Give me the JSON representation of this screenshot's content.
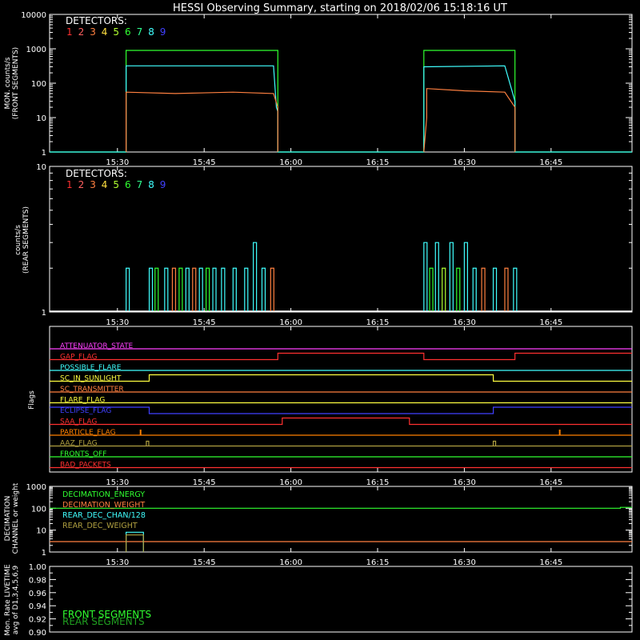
{
  "title": "HESSI Observing Summary, starting on 2018/02/06 15:18:16 UT",
  "detectors": {
    "label": "DETECTORS:",
    "numbers": [
      "1",
      "2",
      "3",
      "4",
      "5",
      "6",
      "7",
      "8",
      "9"
    ],
    "colors": [
      "#ff3030",
      "#ff6060",
      "#ff8040",
      "#ffe040",
      "#b0ff30",
      "#30ff30",
      "#30ff90",
      "#40ffff",
      "#4040ff"
    ]
  },
  "time_axis": {
    "start": "15:18:16",
    "end": "16:59:00",
    "ticks": [
      "15:30",
      "15:45",
      "16:00",
      "16:15",
      "16:30",
      "16:45"
    ]
  },
  "chart_data": [
    {
      "id": "front",
      "type": "line",
      "ylabel": [
        "MON. counts/s",
        "(FRONT SEGMENTS)"
      ],
      "y_scale": "log",
      "ylim": [
        1,
        10000
      ],
      "y_ticks": [
        "1",
        "10",
        "100",
        "1000",
        "10000"
      ],
      "series": [
        {
          "color": "#30ff30",
          "x": [
            "15:18:16",
            "15:31:30",
            "15:31:30",
            "15:57:45",
            "15:57:45",
            "16:23:00",
            "16:23:00",
            "16:38:45",
            "16:38:45",
            "16:59:00"
          ],
          "y": [
            1,
            1,
            900,
            900,
            1,
            1,
            900,
            900,
            1,
            1
          ]
        },
        {
          "color": "#40ffff",
          "x": [
            "15:18:16",
            "15:31:30",
            "15:31:30",
            "15:57:00",
            "15:57:30",
            "15:57:45",
            "15:57:45",
            "16:23:00",
            "16:23:00",
            "16:37:00",
            "16:38:45",
            "16:38:45",
            "16:59:00"
          ],
          "y": [
            1,
            1,
            320,
            320,
            20,
            15,
            1,
            1,
            300,
            320,
            30,
            1,
            1
          ]
        },
        {
          "color": "#ff8040",
          "x": [
            "15:31:30",
            "15:31:30",
            "15:40:00",
            "15:50:00",
            "15:57:00",
            "15:57:45",
            "15:57:45"
          ],
          "y": [
            1,
            55,
            50,
            55,
            50,
            20,
            1
          ]
        },
        {
          "color": "#ff8040",
          "x": [
            "16:23:00",
            "16:23:30",
            "16:23:30",
            "16:30:00",
            "16:37:00",
            "16:38:45",
            "16:38:45"
          ],
          "y": [
            1,
            10,
            70,
            60,
            55,
            20,
            1
          ]
        }
      ]
    },
    {
      "id": "rear",
      "type": "line",
      "ylabel": [
        "counts/s",
        "(REAR SEGMENTS)"
      ],
      "y_scale": "log",
      "ylim": [
        1,
        10
      ],
      "y_ticks": [
        "1",
        "10"
      ],
      "baseline": "#ffffff",
      "spikes": [
        {
          "t": "15:31:30",
          "y": 2,
          "color": "#40ffff"
        },
        {
          "t": "15:35:30",
          "y": 2,
          "color": "#40ffff"
        },
        {
          "t": "15:36:30",
          "y": 2,
          "color": "#30ff30"
        },
        {
          "t": "15:38:10",
          "y": 2,
          "color": "#40ffff"
        },
        {
          "t": "15:39:30",
          "y": 2,
          "color": "#ff8040"
        },
        {
          "t": "15:40:40",
          "y": 2,
          "color": "#30ff30"
        },
        {
          "t": "15:41:50",
          "y": 2,
          "color": "#40ffff"
        },
        {
          "t": "15:43:00",
          "y": 2,
          "color": "#ff8040"
        },
        {
          "t": "15:44:10",
          "y": 2,
          "color": "#40ffff"
        },
        {
          "t": "15:45:20",
          "y": 2,
          "color": "#30ff30"
        },
        {
          "t": "15:46:30",
          "y": 2,
          "color": "#40ffff"
        },
        {
          "t": "15:48:00",
          "y": 2,
          "color": "#40ffff"
        },
        {
          "t": "15:50:00",
          "y": 2,
          "color": "#40ffff"
        },
        {
          "t": "15:52:00",
          "y": 2,
          "color": "#40ffff"
        },
        {
          "t": "15:53:30",
          "y": 3,
          "color": "#40ffff"
        },
        {
          "t": "15:55:00",
          "y": 2,
          "color": "#40ffff"
        },
        {
          "t": "15:56:30",
          "y": 2,
          "color": "#ff8040"
        },
        {
          "t": "16:23:00",
          "y": 3,
          "color": "#40ffff"
        },
        {
          "t": "16:24:00",
          "y": 2,
          "color": "#30ff30"
        },
        {
          "t": "16:25:00",
          "y": 3,
          "color": "#40ffff"
        },
        {
          "t": "16:26:10",
          "y": 2,
          "color": "#b0ff30"
        },
        {
          "t": "16:27:30",
          "y": 3,
          "color": "#40ffff"
        },
        {
          "t": "16:28:40",
          "y": 2,
          "color": "#30ff30"
        },
        {
          "t": "16:30:00",
          "y": 3,
          "color": "#40ffff"
        },
        {
          "t": "16:31:30",
          "y": 2,
          "color": "#40ffff"
        },
        {
          "t": "16:33:00",
          "y": 2,
          "color": "#ff8040"
        },
        {
          "t": "16:35:00",
          "y": 2,
          "color": "#40ffff"
        },
        {
          "t": "16:37:00",
          "y": 2,
          "color": "#ff8040"
        },
        {
          "t": "16:38:30",
          "y": 2,
          "color": "#40ffff"
        }
      ]
    },
    {
      "id": "flags",
      "type": "flags",
      "ylabel": "Flags",
      "rows": [
        {
          "name": "ATTENUATOR_STATE",
          "color": "#ff40ff",
          "steps": [
            {
              "t": "15:18:16",
              "v": 0
            }
          ]
        },
        {
          "name": "GAP_FLAG",
          "color": "#ff3030",
          "steps": [
            {
              "t": "15:18:16",
              "v": 0
            },
            {
              "t": "15:57:45",
              "v": 1
            },
            {
              "t": "16:23:00",
              "v": 0
            },
            {
              "t": "16:38:45",
              "v": 1
            }
          ]
        },
        {
          "name": "POSSIBLE_FLARE",
          "color": "#40ffff",
          "steps": [
            {
              "t": "15:18:16",
              "v": 0
            }
          ]
        },
        {
          "name": "SC_IN_SUNLIGHT",
          "color": "#ffff40",
          "steps": [
            {
              "t": "15:18:16",
              "v": 0
            },
            {
              "t": "15:35:30",
              "v": 1
            },
            {
              "t": "16:35:00",
              "v": 0
            }
          ]
        },
        {
          "name": "SC_TRANSMITTER",
          "color": "#ff8040",
          "steps": [
            {
              "t": "15:18:16",
              "v": 0
            }
          ]
        },
        {
          "name": "FLARE_FLAG",
          "color": "#ffff40",
          "steps": [
            {
              "t": "15:18:16",
              "v": 0
            }
          ]
        },
        {
          "name": "ECLIPSE_FLAG",
          "color": "#4040ff",
          "steps": [
            {
              "t": "15:18:16",
              "v": 1
            },
            {
              "t": "15:35:30",
              "v": 0
            },
            {
              "t": "16:35:00",
              "v": 1
            }
          ]
        },
        {
          "name": "SAA_FLAG",
          "color": "#ff3030",
          "steps": [
            {
              "t": "15:18:16",
              "v": 0
            },
            {
              "t": "15:58:30",
              "v": 1
            },
            {
              "t": "16:20:30",
              "v": 0
            }
          ]
        },
        {
          "name": "PARTICLE_FLAG",
          "color": "#ff8000",
          "steps": [
            {
              "t": "15:18:16",
              "v": 0
            }
          ],
          "ticks": [
            "15:34:00",
            "16:46:30"
          ]
        },
        {
          "name": "AAZ_FLAG",
          "color": "#b0a040",
          "steps": [
            {
              "t": "15:18:16",
              "v": 0
            }
          ],
          "pulses": [
            "15:35:00",
            "16:35:00"
          ]
        },
        {
          "name": "FRONTS_OFF",
          "color": "#30ff30",
          "steps": [
            {
              "t": "15:18:16",
              "v": 0
            }
          ]
        },
        {
          "name": "BAD_PACKETS",
          "color": "#ff3030",
          "steps": [
            {
              "t": "15:18:16",
              "v": 0
            }
          ]
        }
      ]
    },
    {
      "id": "decimation",
      "type": "line",
      "ylabel": [
        "DECIMATION",
        "CHANNEL or weight"
      ],
      "y_scale": "log",
      "ylim": [
        1,
        1000
      ],
      "y_ticks": [
        "1",
        "10",
        "100",
        "1000"
      ],
      "legend": [
        {
          "name": "DECIMATION_ENERGY",
          "color": "#30ff30"
        },
        {
          "name": "DECIMATION_WEIGHT",
          "color": "#ff8040"
        },
        {
          "name": "REAR_DEC_CHAN/128",
          "color": "#40ffff"
        },
        {
          "name": "REAR_DEC_WEIGHT",
          "color": "#b0a040"
        }
      ],
      "series": [
        {
          "color": "#30ff30",
          "x": [
            "15:18:16",
            "16:57:00",
            "16:57:00",
            "16:59:00"
          ],
          "y": [
            100,
            100,
            110,
            110
          ]
        },
        {
          "color": "#ff8040",
          "x": [
            "15:18:16",
            "16:59:00"
          ],
          "y": [
            3,
            3
          ]
        },
        {
          "color": "#40ffff",
          "x": [
            "15:31:30",
            "15:31:30",
            "15:34:30",
            "15:34:30"
          ],
          "y": [
            1,
            8,
            8,
            1
          ]
        },
        {
          "color": "#b0a040",
          "x": [
            "15:31:30",
            "15:31:30",
            "15:34:30",
            "15:34:30"
          ],
          "y": [
            1,
            6,
            6,
            1
          ]
        }
      ]
    },
    {
      "id": "livetime",
      "type": "line",
      "ylabel": [
        "Mon. Rate LIVETIME",
        "avg of D1,3,4,5,6,9"
      ],
      "ylim": [
        0.9,
        1.0
      ],
      "y_ticks": [
        "0.90",
        "0.92",
        "0.94",
        "0.96",
        "0.98",
        "1.00"
      ],
      "legend": [
        {
          "name": "FRONT SEGMENTS",
          "color": "#30ff30"
        },
        {
          "name": "REAR SEGMENTS",
          "color": "#20a020"
        }
      ]
    }
  ]
}
